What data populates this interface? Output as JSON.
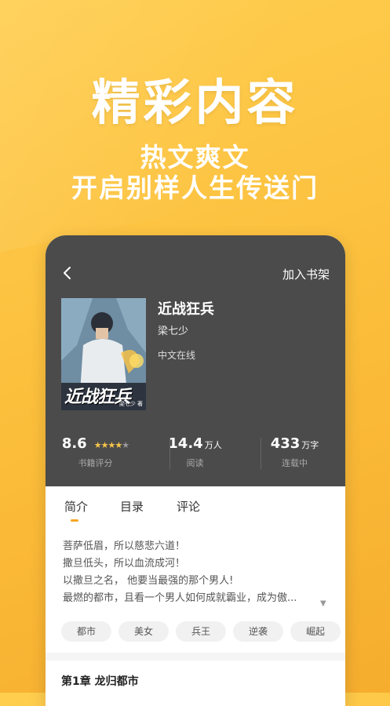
{
  "hero": {
    "title": "精彩内容",
    "subtitle_line1": "热文爽文",
    "subtitle_line2": "开启别样人生传送门"
  },
  "header": {
    "back_icon": "chevron-left-icon",
    "add_shelf_label": "加入书架"
  },
  "book": {
    "title": "近战狂兵",
    "author": "梁七少",
    "source": "中文在线",
    "cover_title": "近战狂兵",
    "cover_author": "梁七少 著"
  },
  "stats": {
    "rating": "8.6",
    "rating_stars": 4,
    "rating_label": "书籍评分",
    "reads": "14.4",
    "reads_unit": "万人",
    "reads_label": "阅读",
    "words": "433",
    "words_unit": "万字",
    "words_label": "连载中"
  },
  "tabs": [
    {
      "label": "简介",
      "active": true
    },
    {
      "label": "目录",
      "active": false
    },
    {
      "label": "评论",
      "active": false
    }
  ],
  "synopsis": [
    "菩萨低眉，所以慈悲六道！",
    "撒旦低头，所以血流成河！",
    "以撒旦之名， 他要当最强的那个男人!",
    "最燃的都市，且看一个男人如何成就霸业，成为傲..."
  ],
  "tags": [
    "都市",
    "美女",
    "兵王",
    "逆袭",
    "崛起"
  ],
  "chapter": {
    "title": "第1章 龙归都市"
  },
  "colors": {
    "accent": "#f5a623",
    "card_dark": "#4b4b4b",
    "background": "#fbbd3a"
  }
}
